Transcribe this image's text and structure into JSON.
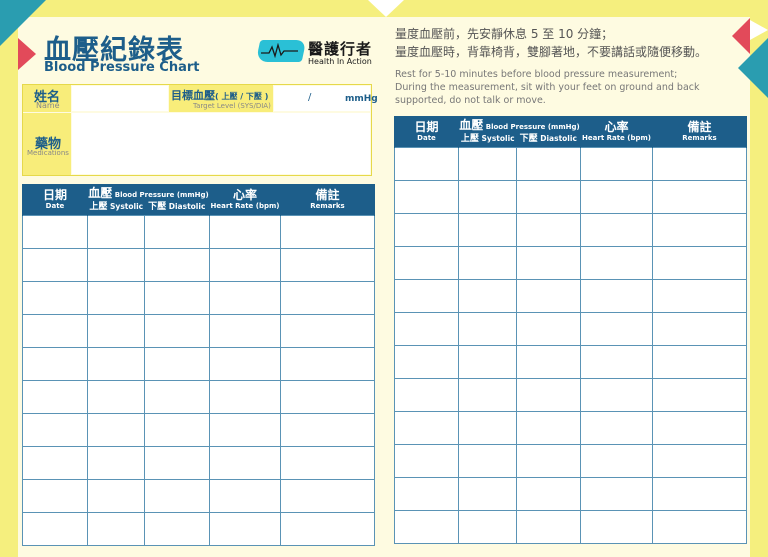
{
  "header": {
    "title_zh": "血壓紀錄表",
    "title_en": "Blood Pressure Chart"
  },
  "logo": {
    "name_zh": "醫護行者",
    "name_en": "Health In Action"
  },
  "form": {
    "name_zh": "姓名",
    "name_en": "Name",
    "target_zh": "目標血壓",
    "target_zh_sub": "( 上壓 / 下壓 )",
    "target_en": "Target  Level (SYS/DIA)",
    "target_sep": "/",
    "unit": "mmHg",
    "meds_zh": "藥物",
    "meds_en": "Medications"
  },
  "instructions": {
    "zh_line1": "量度血壓前，先安靜休息 5 至 10 分鐘；",
    "zh_line2": "量度血壓時，背靠椅背，雙腳著地，不要講話或隨便移動。",
    "en_line1": "Rest for 5-10 minutes before blood pressure measurement;",
    "en_line2": "During the measurement, sit with your feet on ground and back",
    "en_line3": "supported, do not talk or move."
  },
  "table": {
    "date_zh": "日期",
    "date_en": "Date",
    "bp_zh": "血壓",
    "bp_en": "Blood Pressure",
    "bp_unit": "(mmHg)",
    "sys_zh": "上壓",
    "sys_en": "Systolic",
    "dia_zh": "下壓",
    "dia_en": "Diastolic",
    "hr_zh": "心率",
    "hr_en": "Heart Rate (bpm)",
    "remarks_zh": "備註",
    "remarks_en": "Remarks"
  },
  "colors": {
    "primary": "#1d5e8a",
    "accent_teal": "#2a9db0",
    "accent_red": "#e24a5a",
    "background": "#f5ef7e",
    "paper": "#fefbe1"
  }
}
